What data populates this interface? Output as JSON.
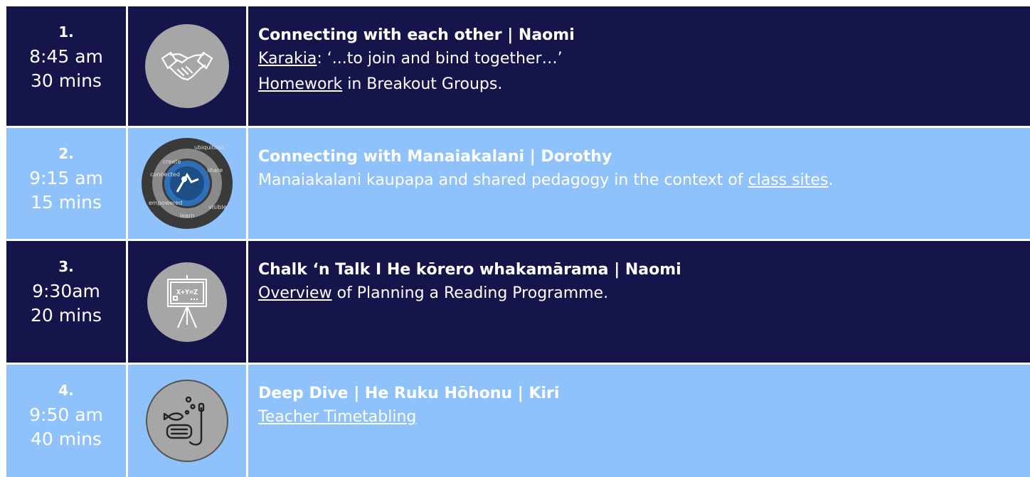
{
  "rows": [
    {
      "number": "1.",
      "time": "8:45 am",
      "duration": "30 mins",
      "icon": "handshake-icon",
      "title": "Connecting with each other | Naomi",
      "line1_link": "Karakia",
      "line1_text": ": ‘...to join and bind together…’",
      "line2_link": "Homework",
      "line2_text": " in Breakout Groups."
    },
    {
      "number": "2.",
      "time": "9:15 am",
      "duration": "15 mins",
      "icon": "manaiakalani-cycle-icon",
      "cycle_words": [
        "create",
        "share",
        "learn",
        "connected",
        "ubiquitous",
        "visible",
        "empowered"
      ],
      "title": "Connecting with Manaiakalani | Dorothy",
      "line1_text": "Manaiakalani kaupapa and shared pedagogy in the context of ",
      "line1_link": "class sites",
      "line1_end": "."
    },
    {
      "number": "3.",
      "time": "9:30am",
      "duration": "20 mins",
      "icon": "chalkboard-icon",
      "board_text": "X+Y=Z",
      "title": "Chalk ‘n Talk I He kōrero whakamārama | Naomi",
      "line1_link": "Overview",
      "line1_text": " of Planning a Reading Programme."
    },
    {
      "number": "4.",
      "time": "9:50 am",
      "duration": "40 mins",
      "icon": "snorkel-mask-icon",
      "title": "Deep Dive  | He Ruku Hōhonu | Kiri",
      "line1_link": "Teacher Timetabling"
    }
  ],
  "colors": {
    "dark_row": "#16154b",
    "light_row": "#8fc1fb",
    "icon_grey": "#a6a6a6",
    "divider": "#ffffff"
  }
}
